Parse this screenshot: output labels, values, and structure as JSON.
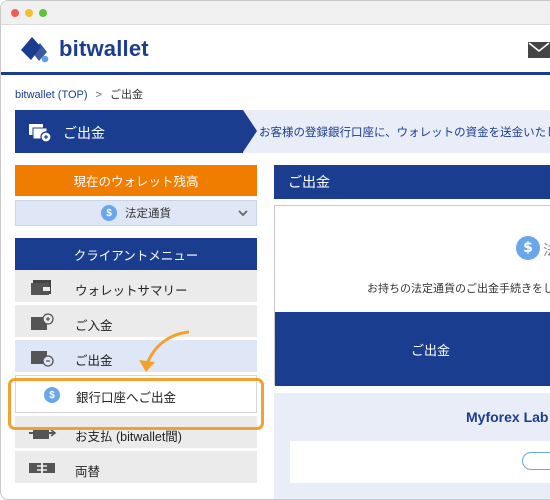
{
  "logo": {
    "text": "bitwallet"
  },
  "breadcrumb": {
    "home": "bitwallet (TOP)",
    "separator": ">",
    "current": "ご出金"
  },
  "banner": {
    "title": "ご出金",
    "description": "お客様の登録銀行口座に、ウォレットの資金を送金いたしま"
  },
  "sidebar": {
    "wallet_balance": "現在のウォレット残高",
    "currency": {
      "coin": "$",
      "selected": "法定通貨"
    },
    "client_menu": "クライアントメニュー",
    "items": [
      {
        "label": "ウォレットサマリー",
        "icon": "wallet-icon"
      },
      {
        "label": "ご入金",
        "icon": "deposit-icon"
      },
      {
        "label": "ご出金",
        "icon": "withdraw-icon"
      },
      {
        "label": "銀行口座へご出金",
        "icon": "dollar-coin-icon"
      },
      {
        "label": "お支払 (bitwallet間)",
        "icon": "payment-icon"
      },
      {
        "label": "両替",
        "icon": "exchange-icon"
      }
    ]
  },
  "main": {
    "heading": "ご出金",
    "coin": "$",
    "coin_label": "法",
    "info": "お持ちの法定通貨のご出金手続きをし",
    "withdraw_button": "ご出金",
    "promo_title": "Myforex Lab"
  },
  "colors": {
    "brand_navy": "#1b3d8f",
    "accent_orange": "#f07d00",
    "highlight": "#f2a12e",
    "coin_blue": "#6aa6ea"
  }
}
